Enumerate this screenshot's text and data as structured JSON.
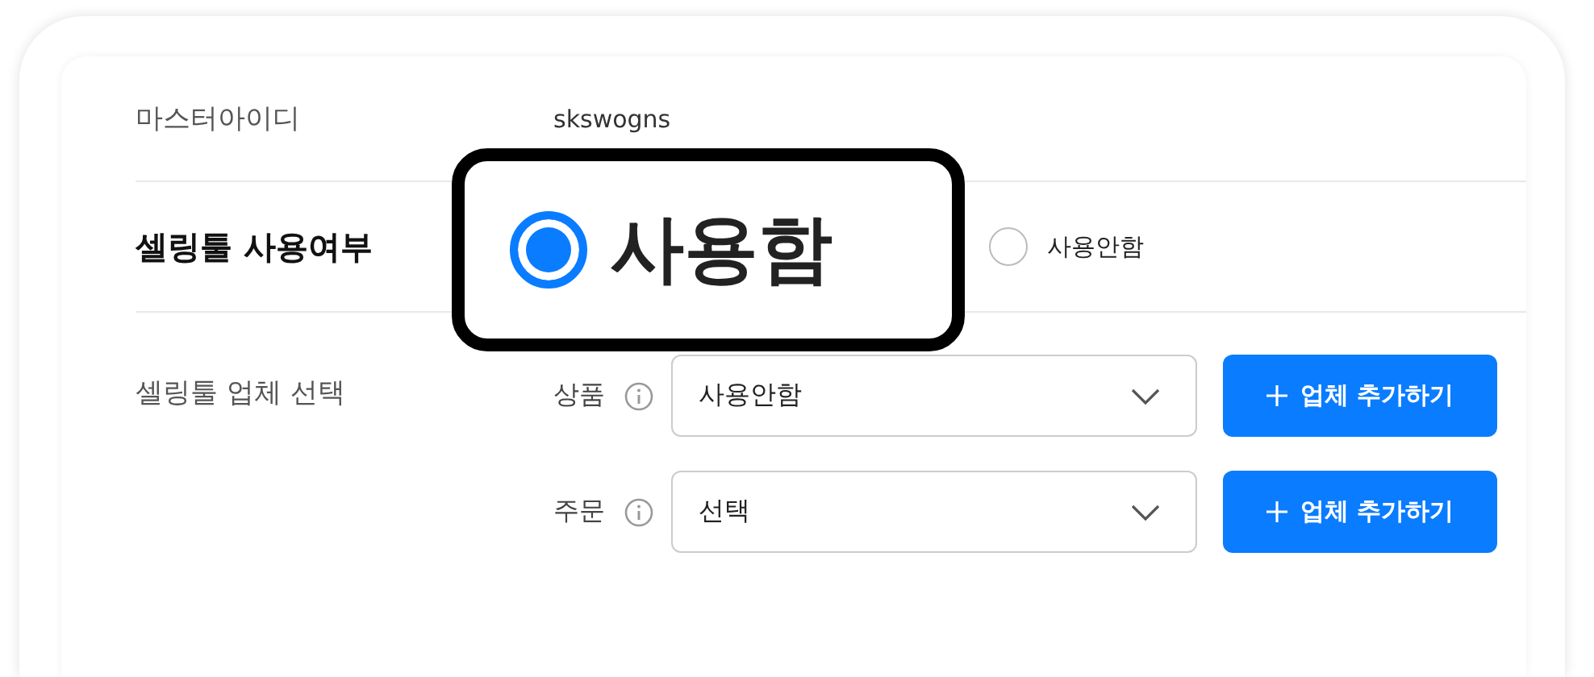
{
  "master_id": {
    "label": "마스터아이디",
    "value": "skswogns"
  },
  "selling_tool_usage": {
    "label": "셀링툴 사용여부",
    "options": [
      {
        "label": "사용함",
        "selected": true
      },
      {
        "label": "사용안함",
        "selected": false
      }
    ]
  },
  "vendor_selection": {
    "label": "셀링툴 업체 선택",
    "rows": [
      {
        "label": "상품",
        "value": "사용안함",
        "button": "업체 추가하기"
      },
      {
        "label": "주문",
        "value": "선택",
        "button": "업체 추가하기"
      }
    ]
  }
}
